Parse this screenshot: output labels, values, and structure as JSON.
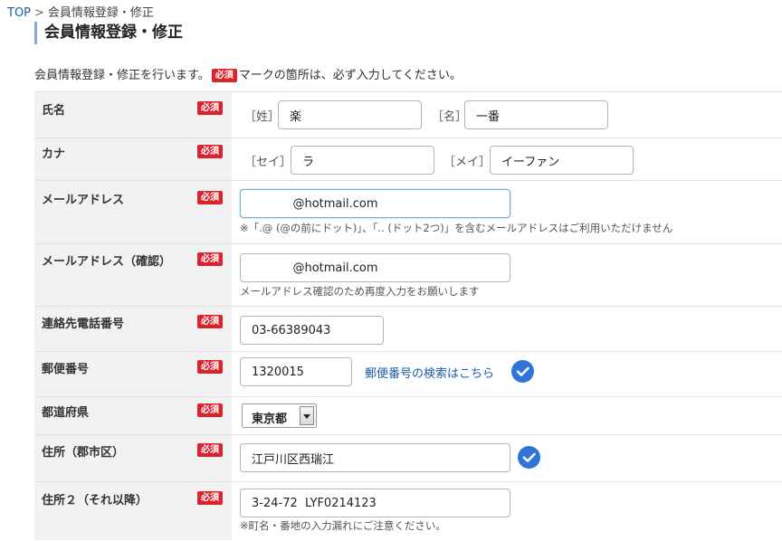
{
  "breadcrumb": {
    "top": "TOP",
    "sep": ">",
    "current": "会員情報登録・修正"
  },
  "page_title": "会員情報登録・修正",
  "intro": {
    "before": "会員情報登録・修正を行います。",
    "after": "マークの箇所は、必ず入力してください。"
  },
  "required_label": "必須",
  "rows": {
    "name": {
      "label": "氏名",
      "sei_prefix": "［姓］",
      "sei_value": "楽",
      "mei_prefix": "［名］",
      "mei_value": "一番"
    },
    "kana": {
      "label": "カナ",
      "sei_prefix": "［セイ］",
      "sei_value": "ラ",
      "mei_prefix": "［メイ］",
      "mei_value": "イーファン"
    },
    "email": {
      "label": "メールアドレス",
      "value": "           @hotmail.com",
      "note": "※「.@ (@の前にドット)」、「.. (ドット2つ)」を含むメールアドレスはご利用いただけません"
    },
    "email_confirm": {
      "label": "メールアドレス（確認）",
      "value": "           @hotmail.com",
      "note": "メールアドレス確認のため再度入力をお願いします"
    },
    "phone": {
      "label": "連絡先電話番号",
      "value": "03-66389043"
    },
    "zip": {
      "label": "郵便番号",
      "value": "1320015",
      "link": "郵便番号の検索はこちら"
    },
    "prefecture": {
      "label": "都道府県",
      "value": "東京都"
    },
    "address1": {
      "label": "住所（郡市区）",
      "value": "江戸川区西瑞江"
    },
    "address2": {
      "label": "住所２（それ以降）",
      "value": "3-24-72  LYF0214123",
      "note": "※町名・番地の入力漏れにご注意ください。"
    }
  },
  "colors": {
    "required": "#d9232d",
    "check": "#2f74d8",
    "link": "#1a5ca8"
  }
}
